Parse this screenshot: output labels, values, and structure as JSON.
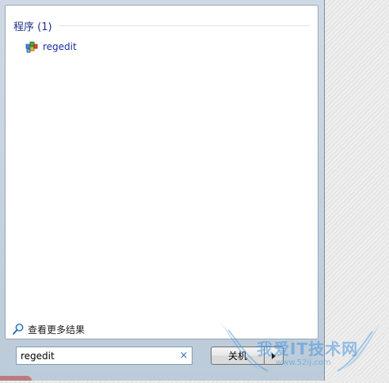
{
  "results": {
    "section_title": "程序 (1)",
    "items": [
      {
        "label": "regedit",
        "icon": "regedit-icon"
      }
    ],
    "more_results": {
      "label": "查看更多结果",
      "icon": "magnifier-icon"
    }
  },
  "search": {
    "value": "regedit",
    "clear_icon": "×"
  },
  "shutdown": {
    "label": "关机",
    "arrow_icon": "chevron-right-icon"
  },
  "watermark": {
    "text": "我爱IT技术网",
    "url": "www.52ij.com"
  },
  "colors": {
    "section_title": "#1e3287",
    "link": "#1a2fa0",
    "frame": "#bccbd9"
  }
}
